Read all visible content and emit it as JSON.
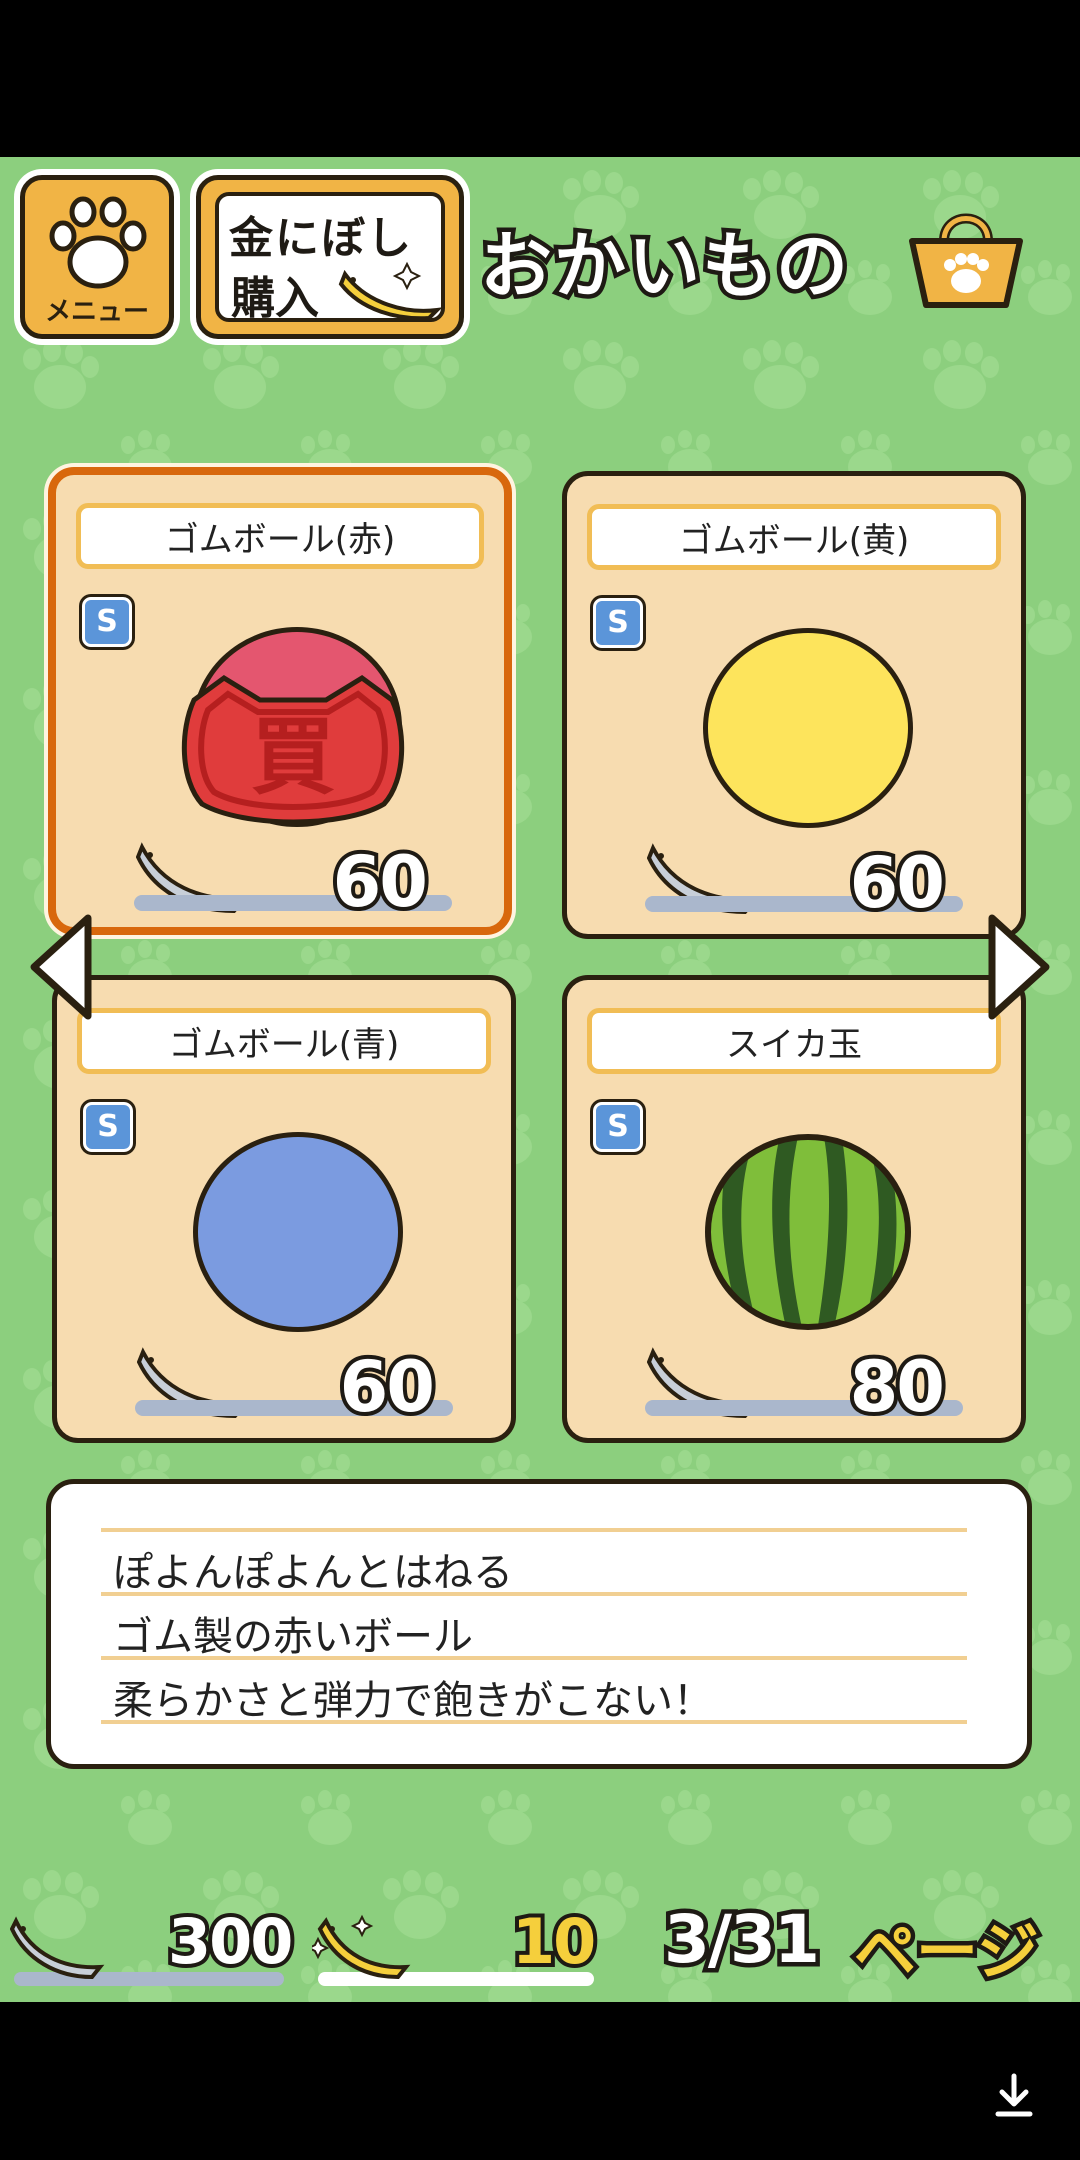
{
  "colors": {
    "background": "#8ccf7e",
    "card": "#f7dcb0",
    "selected_border": "#d8680d",
    "label_border": "#f1bd55",
    "button": "#f1b445",
    "gold_text": "#f5cf3c"
  },
  "header": {
    "menu_label": "メニュー",
    "buy_line1": "金にぼし",
    "buy_line2": "購入",
    "title": "おかいもの"
  },
  "items": [
    {
      "name": "ゴムボール(赤)",
      "price": "60",
      "badge": "S",
      "color": "#e4566f",
      "purchased": true,
      "stamp": "買",
      "selected": true
    },
    {
      "name": "ゴムボール(黄)",
      "price": "60",
      "badge": "S",
      "color": "#fde45c",
      "purchased": false,
      "selected": false
    },
    {
      "name": "ゴムボール(青)",
      "price": "60",
      "badge": "S",
      "color": "#7b9be0",
      "purchased": false,
      "selected": false
    },
    {
      "name": "スイカ玉",
      "price": "80",
      "badge": "S",
      "color": "#7fbe3a",
      "purchased": false,
      "selected": false
    }
  ],
  "description": {
    "lines": [
      "ぽよんぽよんとはねる",
      "ゴム製の赤いボール",
      "柔らかさと弾力で飽きがこない！"
    ]
  },
  "footer": {
    "niboshi": "300",
    "gold_niboshi": "10",
    "page": "3/31",
    "page_label": "ページ"
  }
}
